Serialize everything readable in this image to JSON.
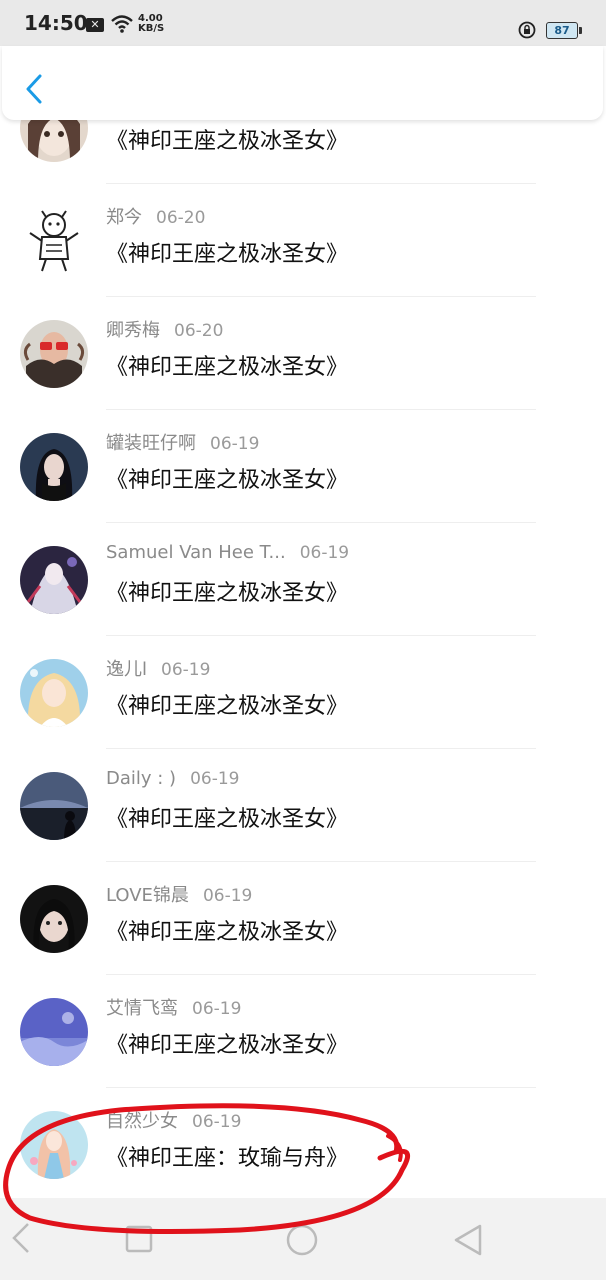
{
  "status_bar": {
    "time": "14:50",
    "speed_value": "4.00",
    "speed_unit": "KB/S",
    "battery": "87"
  },
  "header": {
    "back_icon": "chevron-left-icon",
    "accent": "#1a9be6"
  },
  "items": [
    {
      "name": "",
      "date": "",
      "title": "《神印王座之极冰圣女》"
    },
    {
      "name": "郑今",
      "date": "06-20",
      "title": "《神印王座之极冰圣女》"
    },
    {
      "name": "卿秀梅",
      "date": "06-20",
      "title": "《神印王座之极冰圣女》"
    },
    {
      "name": "罐装旺仔啊",
      "date": "06-19",
      "title": "《神印王座之极冰圣女》"
    },
    {
      "name": "Samuel Van Hee T...",
      "date": "06-19",
      "title": "《神印王座之极冰圣女》"
    },
    {
      "name": "逸儿l",
      "date": "06-19",
      "title": "《神印王座之极冰圣女》"
    },
    {
      "name": "Daily : )",
      "date": "06-19",
      "title": "《神印王座之极冰圣女》"
    },
    {
      "name": "LOVE锦晨",
      "date": "06-19",
      "title": "《神印王座之极冰圣女》"
    },
    {
      "name": "艾情飞鸾",
      "date": "06-19",
      "title": "《神印王座之极冰圣女》"
    },
    {
      "name": "自然少女",
      "date": "06-19",
      "title": "《神印王座：玫瑜与舟》"
    }
  ],
  "nav": {
    "back": "triangle-back-icon",
    "home": "circle-home-icon",
    "recents": "square-recents-icon"
  },
  "annotation_color": "#e0121b"
}
